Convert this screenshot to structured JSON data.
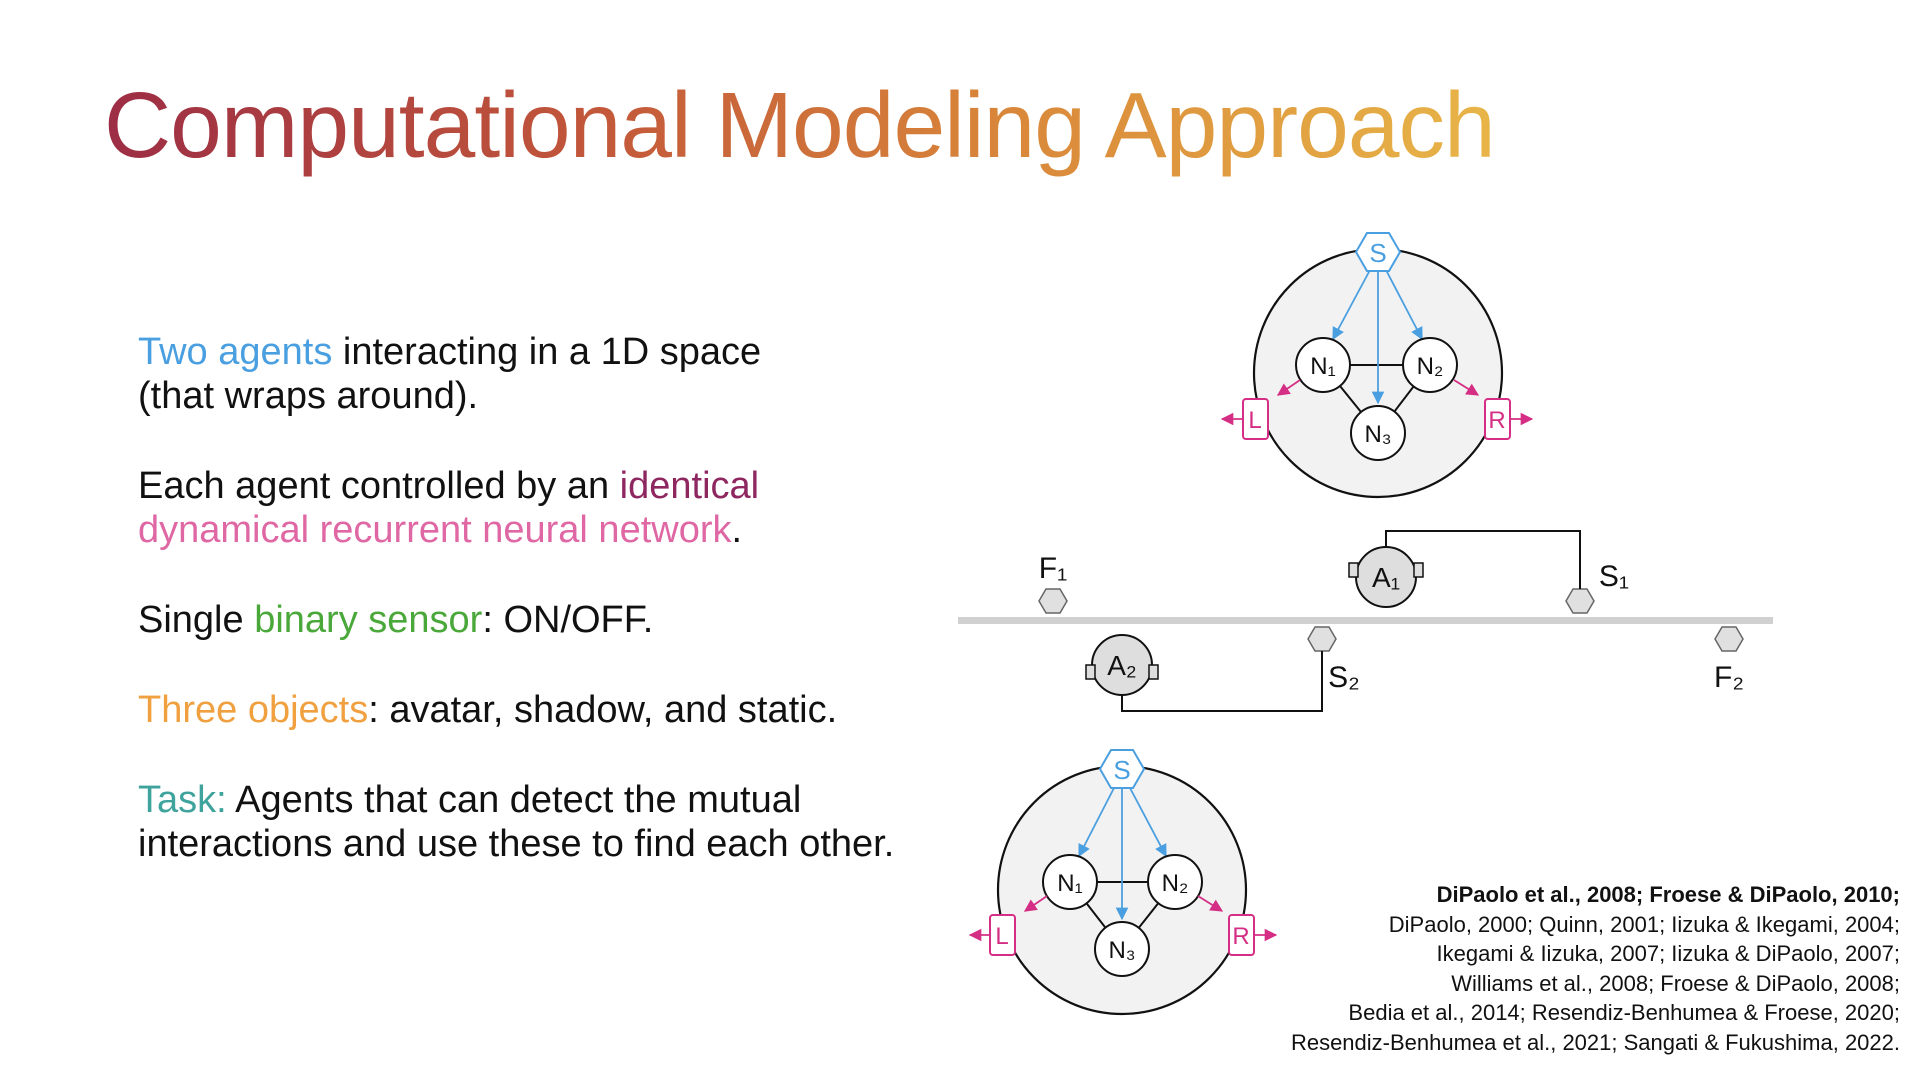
{
  "title": "Computational Modeling Approach",
  "bullets": [
    {
      "highlight": "Two agents",
      "text1": " interacting in a 1D space",
      "text2": "(that wraps around)."
    },
    {
      "text": "Each agent controlled by an ",
      "highlight1": "identical",
      "highlight2": "dynamical recurrent neural network",
      "end": "."
    },
    {
      "highlight": "Single ",
      "highlight_colored": "binary sensor",
      "text": ": ON/OFF."
    },
    {
      "highlight": "Three objects",
      "text": ": avatar, shadow, and static."
    },
    {
      "highlight": "Task:",
      "text": " Agents that can detect the mutual interactions and use these to find each other."
    }
  ],
  "diagram": {
    "sensor": "S",
    "neurons": [
      "N₁",
      "N₂",
      "N₃"
    ],
    "motors": [
      "L",
      "R"
    ],
    "agents": [
      "A₁",
      "A₂"
    ],
    "fixed_objects": [
      "F₁",
      "F₂"
    ],
    "shadows": [
      "S₁",
      "S₂"
    ]
  },
  "references": [
    "DiPaolo et al., 2008; Froese & DiPaolo, 2010;",
    "DiPaolo, 2000; Quinn, 2001; Iizuka & Ikegami, 2004;",
    "Ikegami & Iizuka, 2007; Iizuka & DiPaolo, 2007;",
    "Williams et al., 2008; Froese & DiPaolo, 2008;",
    "Bedia et al., 2014; Resendiz-Benhumea & Froese, 2020;",
    "Resendiz-Benhumea et al., 2021; Sangati & Fukushima, 2022."
  ],
  "colors": {
    "sensor_blue": "#4a9fe0",
    "motor_pink": "#d42f84",
    "title_gradient": [
      "#9c2d45",
      "#e8b548"
    ]
  }
}
